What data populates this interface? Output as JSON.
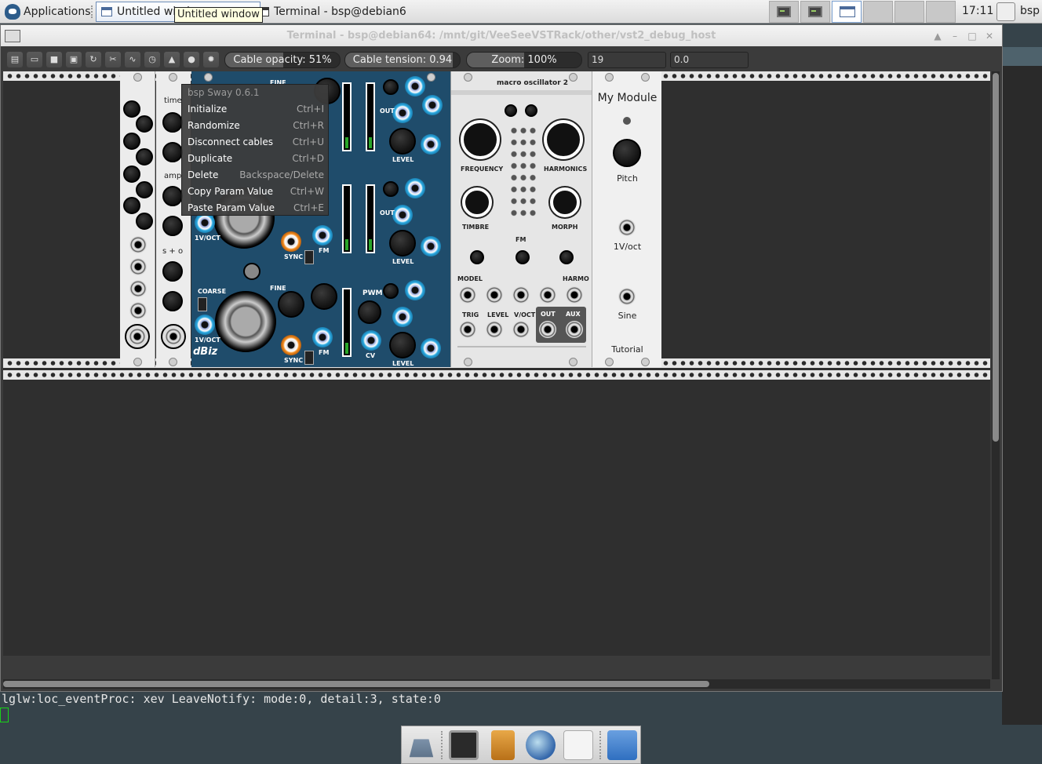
{
  "panel": {
    "applications_label": "Applications",
    "tasks": [
      {
        "label": "Untitled window"
      },
      {
        "label": "Terminal - bsp@debian6..."
      }
    ],
    "tooltip": "Untitled window",
    "clock": "17:11",
    "user": "bsp"
  },
  "window": {
    "title": "Terminal - bsp@debian64: /mnt/git/VeeSeeVSTRack/other/vst2_debug_host"
  },
  "toolbar": {
    "cable_opacity": "Cable opacity: 51%",
    "cable_opacity_level": 0.51,
    "cable_tension": "Cable tension: 0.94",
    "cable_tension_level": 0.94,
    "zoom": "Zoom: 100%",
    "zoom_level": 0.5,
    "field1": "19",
    "field2": "0.0"
  },
  "context_menu": {
    "header": "bsp Sway 0.6.1",
    "items": [
      {
        "label": "Initialize",
        "shortcut": "Ctrl+I"
      },
      {
        "label": "Randomize",
        "shortcut": "Ctrl+R"
      },
      {
        "label": "Disconnect cables",
        "shortcut": "Ctrl+U"
      },
      {
        "label": "Duplicate",
        "shortcut": "Ctrl+D"
      },
      {
        "label": "Delete",
        "shortcut": "Backspace/Delete"
      },
      {
        "label": "Copy Param Value",
        "shortcut": "Ctrl+W"
      },
      {
        "label": "Paste Param Value",
        "shortcut": "Ctrl+E"
      }
    ]
  },
  "modules": {
    "sway": {
      "time": "time",
      "amp": "amp",
      "so": "s + o"
    },
    "dbiz": {
      "coarse": "COARSE",
      "fine": "FINE",
      "fine2": "FINE",
      "voct": "1V/OCT",
      "voct2": "1V/OCT",
      "sync": "SYNC",
      "sync2": "SYNC",
      "fm": "FM",
      "fm2": "FM",
      "out": "OUT",
      "out2": "OUT",
      "level": "LEVEL",
      "level2": "LEVEL",
      "level3": "LEVEL",
      "pwm": "PWM",
      "cv": "CV",
      "brand": "dBiz"
    },
    "macro": {
      "title": "macro oscillator 2",
      "frequency": "FREQUENCY",
      "harmonics": "HARMONICS",
      "timbre": "TIMBRE",
      "morph": "MORPH",
      "fm": "FM",
      "model": "MODEL",
      "harmo": "HARMO",
      "trig": "TRIG",
      "level": "LEVEL",
      "voct": "V/OCT",
      "out": "OUT",
      "aux": "AUX"
    },
    "mymodule": {
      "title": "My Module",
      "pitch": "Pitch",
      "voct": "1V/oct",
      "sine": "Sine",
      "tutorial": "Tutorial"
    }
  },
  "terminal_output": "lglw:loc_eventProc: xev LeaveNotify: mode:0, detail:3, state:0"
}
